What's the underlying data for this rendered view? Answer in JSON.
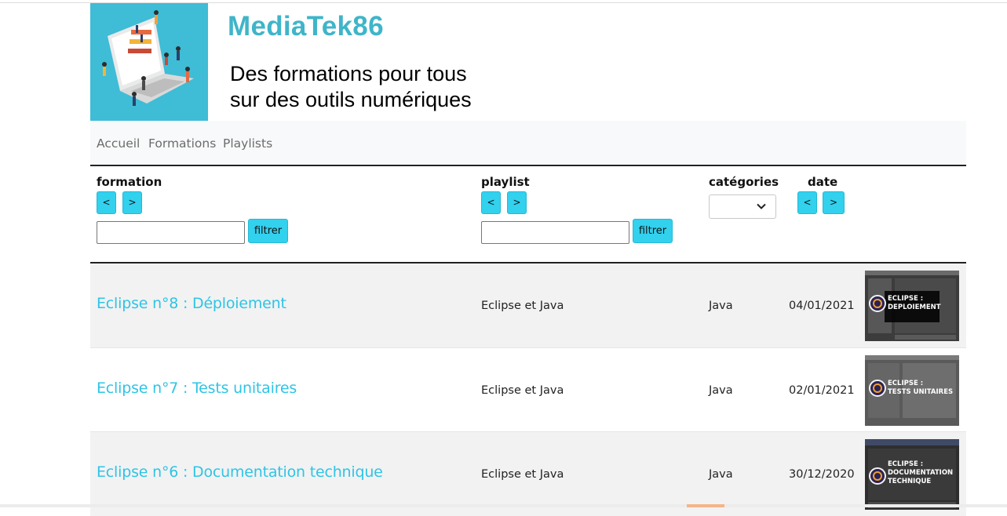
{
  "header": {
    "site_title": "MediaTek86",
    "tagline_line1": "Des formations pour tous",
    "tagline_line2": "sur des outils numériques"
  },
  "nav": {
    "items": [
      {
        "label": "Accueil"
      },
      {
        "label": "Formations"
      },
      {
        "label": "Playlists"
      }
    ]
  },
  "filters": {
    "formation": {
      "title": "formation",
      "sort_asc": "<",
      "sort_desc": ">",
      "input_value": "",
      "button": "filtrer"
    },
    "playlist": {
      "title": "playlist",
      "sort_asc": "<",
      "sort_desc": ">",
      "input_value": "",
      "button": "filtrer"
    },
    "categories": {
      "title": "catégories",
      "selected": "",
      "icon": "chevron-down-icon"
    },
    "date": {
      "title": "date",
      "sort_asc": "<",
      "sort_desc": ">"
    }
  },
  "rows": [
    {
      "title": "Eclipse n°8 : Déploiement",
      "playlist": "Eclipse et Java",
      "category": "Java",
      "date": "04/01/2021",
      "thumb_line1": "ECLIPSE :",
      "thumb_line2": "DEPLOIEMENT",
      "thumb_line3": ""
    },
    {
      "title": "Eclipse n°7 : Tests unitaires",
      "playlist": "Eclipse et Java",
      "category": "Java",
      "date": "02/01/2021",
      "thumb_line1": "ECLIPSE :",
      "thumb_line2": "TESTS UNITAIRES",
      "thumb_line3": ""
    },
    {
      "title": "Eclipse n°6 : Documentation technique",
      "playlist": "Eclipse et Java",
      "category": "Java",
      "date": "30/12/2020",
      "thumb_line1": "ECLIPSE :",
      "thumb_line2": "DOCUMENTATION",
      "thumb_line3": "TECHNIQUE"
    }
  ],
  "colors": {
    "accent": "#32d1ee",
    "link": "#2ec4e6",
    "title": "#3fb5c9",
    "logo_bg": "#3fbcd6"
  }
}
